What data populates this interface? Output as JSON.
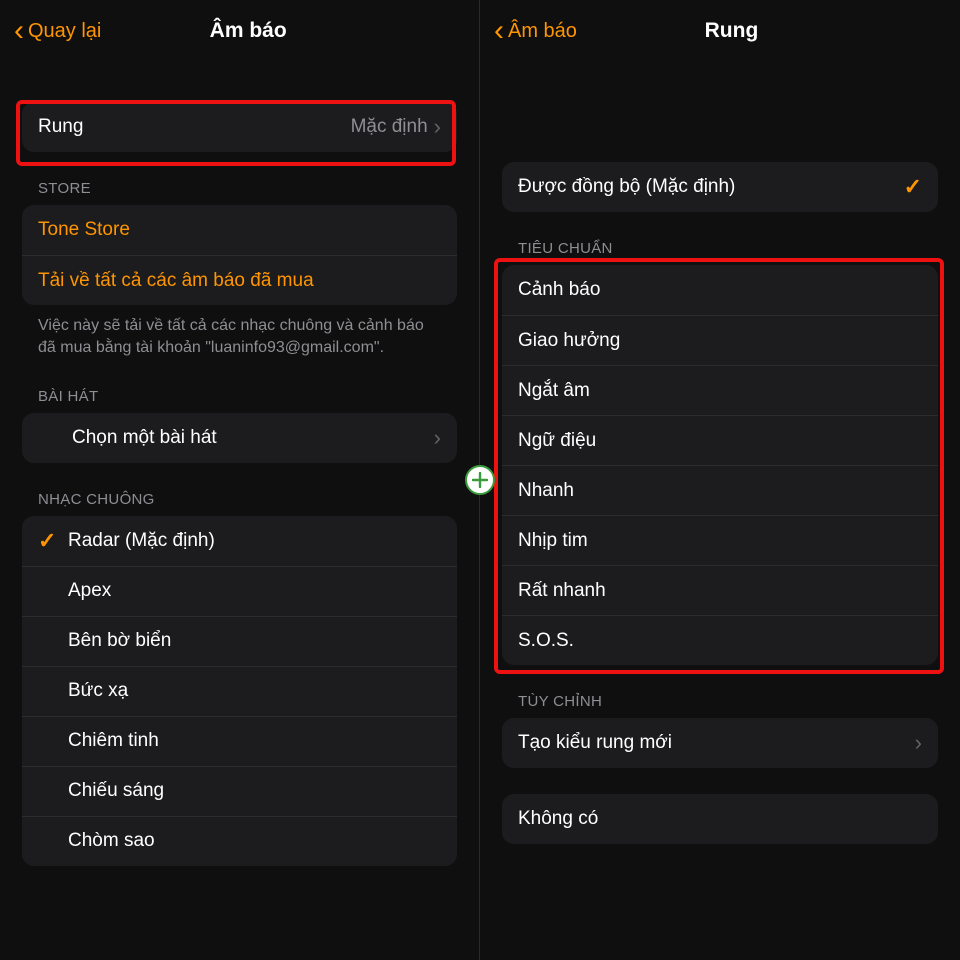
{
  "left": {
    "nav": {
      "back": "Quay lại",
      "title": "Âm báo"
    },
    "vibration": {
      "label": "Rung",
      "value": "Mặc định"
    },
    "store": {
      "header": "STORE",
      "tone_store": "Tone Store",
      "download_all": "Tải về tất cả các âm báo đã mua",
      "footer": "Việc này sẽ tải về tất cả các nhạc chuông và cảnh báo đã mua bằng tài khoản \"luaninfo93@gmail.com\"."
    },
    "songs": {
      "header": "BÀI HÁT",
      "pick": "Chọn một bài hát"
    },
    "ringtones": {
      "header": "NHẠC CHUÔNG",
      "items": [
        {
          "label": "Radar (Mặc định)",
          "checked": true
        },
        {
          "label": "Apex"
        },
        {
          "label": "Bên bờ biển"
        },
        {
          "label": "Bức xạ"
        },
        {
          "label": "Chiêm tinh"
        },
        {
          "label": "Chiếu sáng"
        },
        {
          "label": "Chòm sao"
        }
      ]
    }
  },
  "right": {
    "nav": {
      "back": "Âm báo",
      "title": "Rung"
    },
    "synced": {
      "label": "Được đồng bộ (Mặc định)",
      "checked": true
    },
    "standard": {
      "header": "TIÊU CHUẨN",
      "items": [
        "Cảnh báo",
        "Giao hưởng",
        "Ngắt âm",
        "Ngữ điệu",
        "Nhanh",
        "Nhịp tim",
        "Rất nhanh",
        "S.O.S."
      ]
    },
    "custom": {
      "header": "TÙY CHỈNH",
      "create": "Tạo kiểu rung mới"
    },
    "none": "Không có"
  }
}
